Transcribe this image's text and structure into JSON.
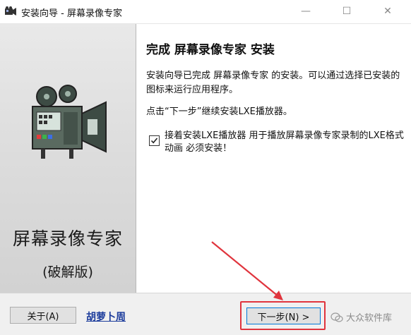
{
  "window": {
    "title": "安装向导 - 屏幕录像专家",
    "controls": {
      "minimize": "—",
      "maximize": "☐",
      "close": "✕"
    }
  },
  "sidebar": {
    "product_name": "屏幕录像专家",
    "edition": "(破解版)"
  },
  "main": {
    "heading": "完成 屏幕录像专家 安装",
    "paragraph1": "安装向导已完成 屏幕录像专家 的安装。可以通过选择已安装的图标来运行应用程序。",
    "paragraph2": "点击“下一步”继续安装LXE播放器。",
    "checkbox": {
      "checked": true,
      "label": "接着安装LXE播放器 用于播放屏幕录像专家录制的LXE格式动画 必须安装！"
    }
  },
  "footer": {
    "about_button": "关于(A)",
    "link_text": "胡萝卜周",
    "next_button": "下一步(N) >"
  },
  "watermark": {
    "text": "大众软件库"
  },
  "colors": {
    "annotation_red": "#e0343d",
    "link_blue": "#1c3c9c",
    "focus_blue": "#0078d7"
  }
}
